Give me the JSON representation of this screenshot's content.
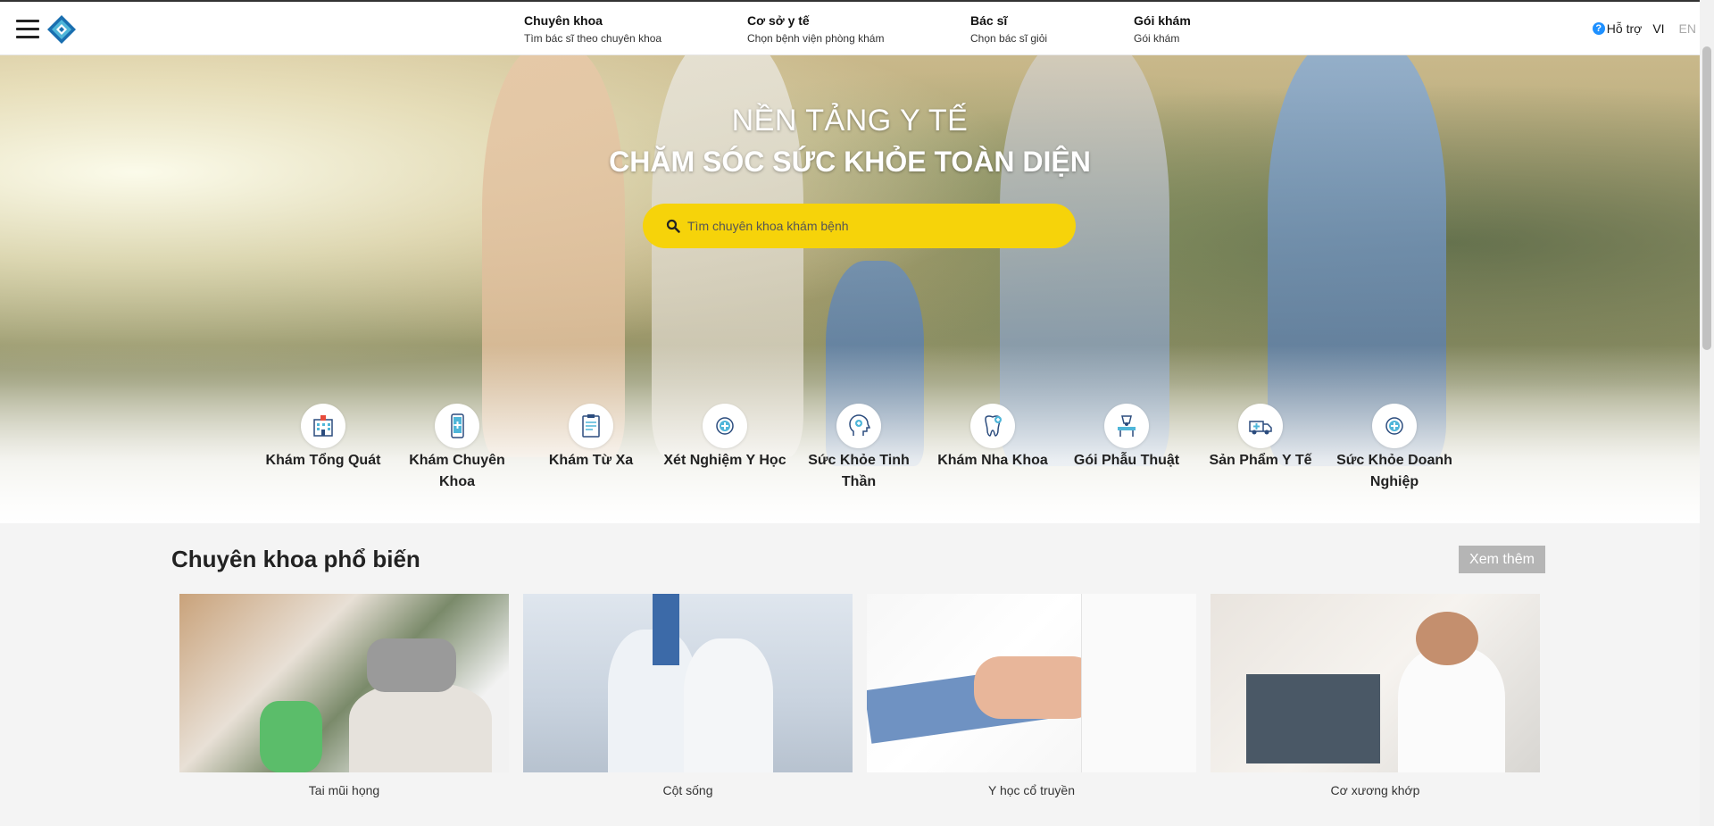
{
  "header": {
    "menu_icon": "hamburger-menu-icon",
    "logo_icon": "bookingcare-logo-icon",
    "nav": [
      {
        "title": "Chuyên khoa",
        "subtitle": "Tìm bác sĩ theo chuyên khoa"
      },
      {
        "title": "Cơ sở y tế",
        "subtitle": "Chọn bệnh viện phòng khám"
      },
      {
        "title": "Bác sĩ",
        "subtitle": "Chọn bác sĩ giỏi"
      },
      {
        "title": "Gói khám",
        "subtitle": "Gói khám"
      }
    ],
    "support_label": "Hỗ trợ",
    "lang_vi": "VI",
    "lang_en": "EN"
  },
  "hero": {
    "title_line1": "NỀN TẢNG Y TẾ",
    "title_line2": "CHĂM SÓC SỨC KHỎE TOÀN DIỆN",
    "search_placeholder": "Tìm chuyên khoa khám bệnh",
    "search_color": "#f6d30a",
    "options": [
      {
        "label": "Khám Tổng Quát",
        "icon": "hospital-icon"
      },
      {
        "label": "Khám Chuyên Khoa",
        "icon": "phone-medical-icon"
      },
      {
        "label": "Khám Từ Xa",
        "icon": "clipboard-icon"
      },
      {
        "label": "Xét Nghiệm Y Học",
        "icon": "medical-cross-icon"
      },
      {
        "label": "Sức Khỏe Tinh Thần",
        "icon": "head-mind-icon"
      },
      {
        "label": "Khám Nha Khoa",
        "icon": "tooth-icon"
      },
      {
        "label": "Gói Phẫu Thuật",
        "icon": "surgery-icon"
      },
      {
        "label": "Sản Phẩm Y Tế",
        "icon": "ambulance-icon"
      },
      {
        "label": "Sức Khỏe Doanh Nghiệp",
        "icon": "medical-cross-icon"
      }
    ]
  },
  "specialty": {
    "title": "Chuyên khoa phổ biến",
    "more_label": "Xem thêm",
    "items": [
      {
        "label": "Tai mũi họng"
      },
      {
        "label": "Cột sống"
      },
      {
        "label": "Y học cổ truyền"
      },
      {
        "label": "Cơ xương khớp"
      }
    ]
  }
}
